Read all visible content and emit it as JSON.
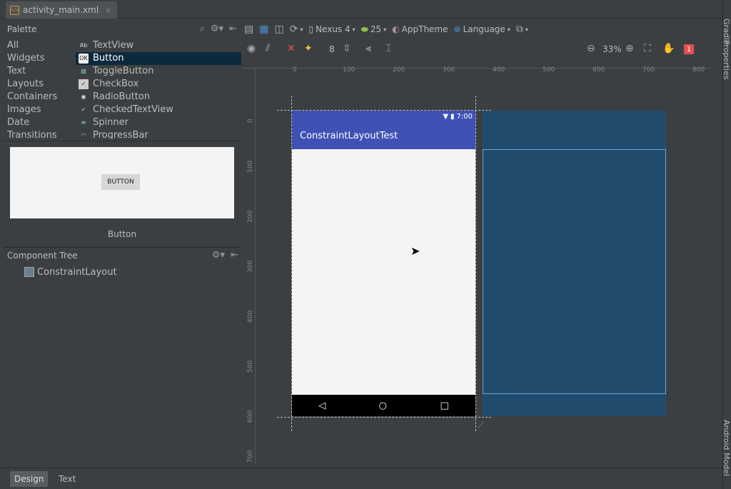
{
  "file_tab": {
    "name": "activity_main.xml",
    "close": "×",
    "icon": "</>"
  },
  "palette": {
    "title": "Palette",
    "categories": [
      "All",
      "Widgets",
      "Text",
      "Layouts",
      "Containers",
      "Images",
      "Date",
      "Transitions"
    ],
    "items": [
      {
        "icon": "Ab",
        "label": "TextView"
      },
      {
        "icon": "OK",
        "label": "Button"
      },
      {
        "icon": "▧",
        "label": "ToggleButton"
      },
      {
        "icon": "✓",
        "label": "CheckBox"
      },
      {
        "icon": "◉",
        "label": "RadioButton"
      },
      {
        "icon": "✓",
        "label": "CheckedTextView"
      },
      {
        "icon": "≡",
        "label": "Spinner"
      },
      {
        "icon": "◠",
        "label": "ProgressBar"
      }
    ],
    "preview_button": "BUTTON",
    "preview_label": "Button"
  },
  "component_tree": {
    "title": "Component Tree",
    "root": "ConstraintLayout"
  },
  "toolbar": {
    "device": "Nexus 4",
    "api": "25",
    "theme": "AppTheme",
    "language": "Language",
    "margin": "8",
    "zoom": "33%",
    "error_count": "1"
  },
  "rulers": {
    "top": [
      "0",
      "100",
      "200",
      "300",
      "400",
      "500",
      "600",
      "700",
      "800"
    ],
    "left": [
      "0",
      "100",
      "200",
      "300",
      "400",
      "500",
      "600",
      "700"
    ]
  },
  "phone": {
    "time": "7:00",
    "app_title": "ConstraintLayoutTest",
    "nav_back": "◁",
    "nav_home": "○",
    "nav_recent": "□"
  },
  "sidebar_right": {
    "properties": "Properties",
    "gradle": "Gradle",
    "android_model": "Android Model"
  },
  "bottom_tabs": {
    "design": "Design",
    "text": "Text"
  },
  "colors": {
    "accent": "#3f51b5",
    "blueprint": "#204b6d",
    "selection": "#0d293e",
    "error": "#e05252"
  }
}
